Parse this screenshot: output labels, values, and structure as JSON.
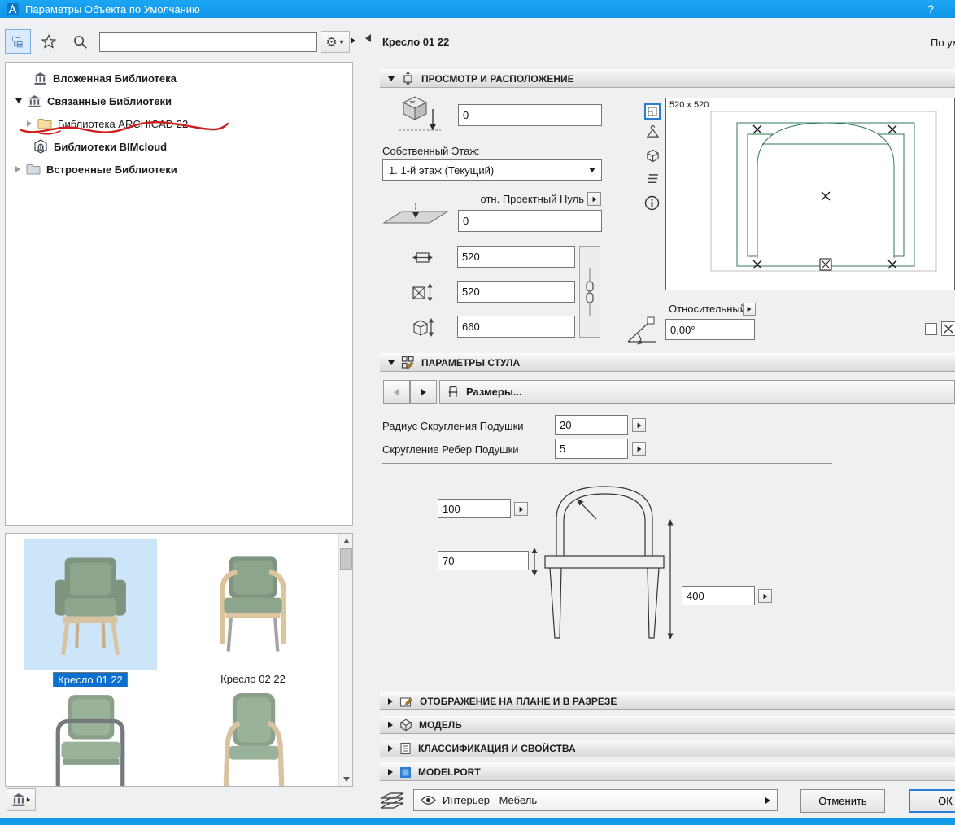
{
  "titlebar": {
    "title": "Параметры Объекта по Умолчанию",
    "help": "?"
  },
  "icons_text": {
    "gear": "⚙"
  },
  "colors": {
    "titlebar_blue": "#109ae9",
    "selection_blue": "#0b6fd0",
    "preview_green": "#2f7a54",
    "annotation_red": "#cf1d1d"
  },
  "left_panel": {
    "search_value": "",
    "tree": {
      "items": [
        {
          "label": "Вложенная Библиотека"
        },
        {
          "label": "Связанные Библиотеки"
        },
        {
          "label": "Библиотека ARCHICAD 22"
        },
        {
          "label": "Библиотеки BIMcloud"
        },
        {
          "label": "Встроенные Библиотеки"
        }
      ]
    },
    "thumbnails": {
      "items": [
        {
          "label": "Кресло 01 22",
          "selected": true
        },
        {
          "label": "Кресло 02 22",
          "selected": false
        }
      ]
    }
  },
  "header": {
    "object_name": "Кресло 01 22",
    "default_label": "По ум"
  },
  "placement": {
    "section_title": "ПРОСМОТР И РАСПОЛОЖЕНИЕ",
    "top_offset": "0",
    "story_label": "Собственный Этаж:",
    "story_value": "1. 1-й этаж (Текущий)",
    "reference_label": "отн. Проектный Нуль",
    "bottom_offset": "0",
    "width": "520",
    "depth": "520",
    "height": "660",
    "preview_size": "520 x 520",
    "relative_label": "Относительный",
    "rotation_angle": "0,00°"
  },
  "chair_params": {
    "section_title": "ПАРАМЕТРЫ СТУЛА",
    "page_label": "Размеры...",
    "rows": [
      {
        "label": "Радиус Скругления Подушки",
        "value": "20"
      },
      {
        "label": "Скругление Ребер Подушки",
        "value": "5"
      }
    ],
    "diagram": {
      "back_radius": "100",
      "cushion_height": "70",
      "seat_height": "400"
    }
  },
  "collapsed_sections": [
    {
      "title": "ОТОБРАЖЕНИЕ НА ПЛАНЕ И В РАЗРЕЗЕ"
    },
    {
      "title": "МОДЕЛЬ"
    },
    {
      "title": "КЛАССИФИКАЦИЯ И СВОЙСТВА"
    },
    {
      "title": "MODELPORT"
    }
  ],
  "footer": {
    "layer_name": "Интерьер - Мебель",
    "cancel_label": "Отменить",
    "ok_label": "ОК"
  }
}
